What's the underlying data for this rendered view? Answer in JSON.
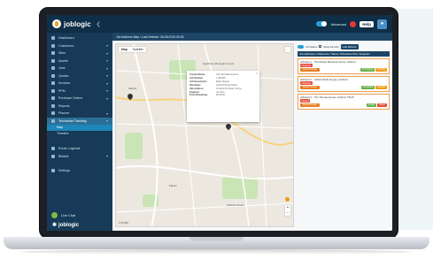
{
  "app": {
    "brand": "joblogic",
    "help_label": "Help",
    "header_toggle_label": "Advanced",
    "collapse_icon": "chevron-left-icon"
  },
  "sidebar": {
    "items": [
      {
        "label": "Dashboard",
        "icon": "dashboard-icon"
      },
      {
        "label": "Customers",
        "icon": "people-icon"
      },
      {
        "label": "Sites",
        "icon": "building-icon"
      },
      {
        "label": "Assets",
        "icon": "box-icon"
      },
      {
        "label": "Jobs",
        "icon": "wrench-icon"
      },
      {
        "label": "Quotes",
        "icon": "quote-icon"
      },
      {
        "label": "Invoices",
        "icon": "invoice-icon"
      },
      {
        "label": "PPM",
        "icon": "calendar-icon"
      },
      {
        "label": "Purchase Orders",
        "icon": "cart-icon"
      },
      {
        "label": "Reports",
        "icon": "chart-icon"
      },
      {
        "label": "Planner",
        "icon": "planner-icon"
      },
      {
        "label": "Technician Tracking",
        "icon": "map-icon"
      }
    ],
    "sub_items": [
      {
        "label": "Map"
      },
      {
        "label": "Timeline"
      }
    ],
    "lower_items": [
      {
        "label": "Route Logbook",
        "icon": "route-icon"
      },
      {
        "label": "Billable",
        "icon": "pound-icon"
      },
      {
        "label": "Settings",
        "icon": "gear-icon"
      }
    ],
    "live_chat": "Live Chat",
    "footer_brand": "joblogic"
  },
  "content": {
    "subheader": "Job Address Map / Last Refresh: 06:08:2019 09:35",
    "map_tabs": [
      "Map",
      "Satellite"
    ],
    "popup": [
      {
        "k": "Contact Name",
        "v": "Jeff Hart Maintenance"
      },
      {
        "k": "Job Number",
        "v": "J-000235"
      },
      {
        "k": "Job Description",
        "v": "Boiler Repair"
      },
      {
        "k": "Site Name",
        "v": "Ashcroft Road Office"
      },
      {
        "k": "Site Address",
        "v": "14 Ashcroft Road, Surrey"
      },
      {
        "k": "Engineer",
        "v": "Jon Doe"
      },
      {
        "k": "Time Remaining",
        "v": "00:45:00"
      }
    ],
    "google_mark": "Google",
    "zoom_in": "+",
    "zoom_out": "−",
    "map_labels": [
      "Spelthorne Borough Council",
      "Staines",
      "Egham",
      "Laleham Reach"
    ]
  },
  "right_panel": {
    "filter_label": "Job Status",
    "show_all_label": "Show All Jobs",
    "refresh_label": "Last Refresh",
    "list_header": "Job Addresses / Reference / Status / Scheduled Time / Engineer",
    "jobs": [
      {
        "ref": "Jeff Hart 1",
        "site": "The Rowan Business Centre, Ashford",
        "status": "Overdue",
        "action": "Resend Assign",
        "chips": [
          "In Progress",
          "Pending"
        ]
      },
      {
        "ref": "Jeff Hart 2",
        "site": "Ashford Park Surgery, Ashford",
        "status": "Overdue",
        "action": "Resend Assign",
        "chips": [
          "Completed",
          "Pending"
        ]
      },
      {
        "ref": "Jeff Hart 3",
        "site": "The Thomas House, Ashford, TW15",
        "status": "Urgent",
        "action": "Resend Assign",
        "chips": [
          "Accept",
          "Reject"
        ]
      }
    ]
  },
  "colors": {
    "topbar": "#0f2e47",
    "sidebar": "#163a57",
    "accent": "#27a0d8",
    "orange": "#f39c12"
  }
}
